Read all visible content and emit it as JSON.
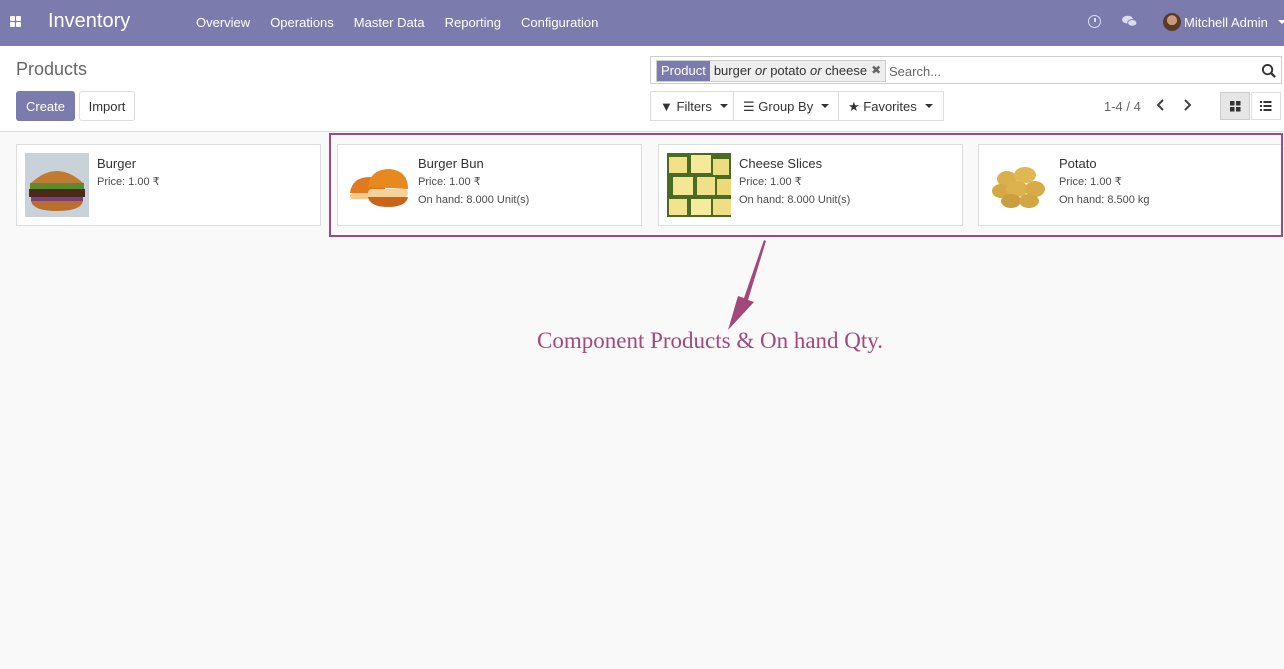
{
  "navbar": {
    "brand": "Inventory",
    "menu": [
      "Overview",
      "Operations",
      "Master Data",
      "Reporting",
      "Configuration"
    ],
    "user": "Mitchell Admin",
    "icons": [
      "apps-icon",
      "clock-icon",
      "chat-icon"
    ]
  },
  "control": {
    "title": "Products",
    "create_label": "Create",
    "import_label": "Import",
    "search": {
      "facet_label": "Product",
      "facet_values": [
        "burger",
        "potato",
        "cheese"
      ],
      "facet_separator": "or",
      "placeholder": "Search..."
    },
    "filters_label": "Filters",
    "groupby_label": "Group By",
    "favorites_label": "Favorites",
    "pager": "1-4 / 4"
  },
  "products": [
    {
      "name": "Burger",
      "price": "Price: 1.00 ₹",
      "onhand": ""
    },
    {
      "name": "Burger Bun",
      "price": "Price: 1.00 ₹",
      "onhand": "On hand: 8.000 Unit(s)"
    },
    {
      "name": "Cheese Slices",
      "price": "Price: 1.00 ₹",
      "onhand": "On hand: 8.000 Unit(s)"
    },
    {
      "name": "Potato",
      "price": "Price: 1.00 ₹",
      "onhand": "On hand: 8.500 kg"
    }
  ],
  "annotation": "Component Products & On hand Qty.",
  "colors": {
    "brand": "#7c7bad",
    "annotation": "#a3497a"
  }
}
